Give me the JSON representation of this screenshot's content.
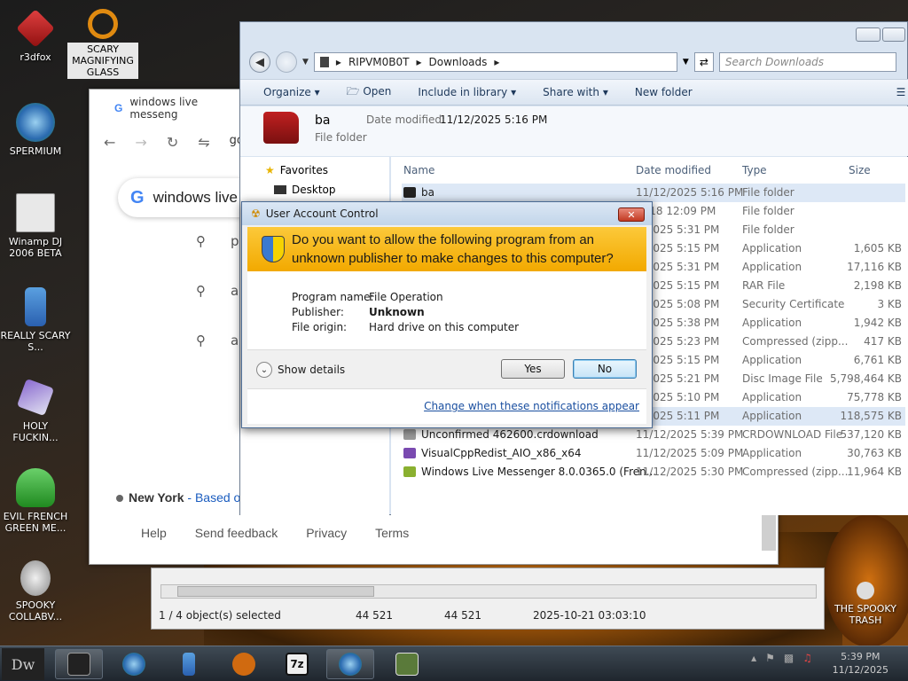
{
  "desktop": {
    "icons": [
      {
        "label": "r3dfox"
      },
      {
        "label": "SCARY MAGNIFYING GLASS"
      },
      {
        "label": "SPERMIUM"
      },
      {
        "label": "Winamp DJ 2006 BETA"
      },
      {
        "label": "REALLY SCARY S..."
      },
      {
        "label": "HOLY FUCKIN..."
      },
      {
        "label": "EVIL FRENCH GREEN ME..."
      },
      {
        "label": "SPOOKY COLLABV..."
      },
      {
        "label": "THE SPOOKY TRASH"
      }
    ]
  },
  "browser": {
    "tab_title": "windows live messeng",
    "search_query": "windows live",
    "suggestions": [
      "p",
      "a",
      "a"
    ],
    "location_city": "New York",
    "location_link": "- Based or",
    "footer_links": [
      "Help",
      "Send feedback",
      "Privacy",
      "Terms"
    ],
    "address_fragment": "go"
  },
  "explorer": {
    "breadcrumb": [
      "RIPVM0B0T",
      "Downloads"
    ],
    "search_placeholder": "Search Downloads",
    "toolbar": [
      "Organize",
      "Open",
      "Include in library",
      "Share with",
      "New folder"
    ],
    "details": {
      "name": "ba",
      "type": "File folder",
      "date_label": "Date modified:",
      "date_value": "11/12/2025 5:16 PM"
    },
    "nav": {
      "favorites": "Favorites",
      "desktop": "Desktop"
    },
    "columns": {
      "name": "Name",
      "date": "Date modified",
      "type": "Type",
      "size": "Size"
    },
    "rows": [
      {
        "name": "ba",
        "date": "11/12/2025 5:16 PM",
        "type": "File folder",
        "size": ""
      },
      {
        "name": "",
        "date": "2018 12:09 PM",
        "type": "File folder",
        "size": ""
      },
      {
        "name": "",
        "date": "2/2025 5:31 PM",
        "type": "File folder",
        "size": ""
      },
      {
        "name": "",
        "date": "2/2025 5:15 PM",
        "type": "Application",
        "size": "1,605 KB"
      },
      {
        "name": "",
        "date": "2/2025 5:31 PM",
        "type": "Application",
        "size": "17,116 KB"
      },
      {
        "name": "",
        "date": "2/2025 5:15 PM",
        "type": "RAR File",
        "size": "2,198 KB"
      },
      {
        "name": "",
        "date": "2/2025 5:08 PM",
        "type": "Security Certificate",
        "size": "3 KB"
      },
      {
        "name": "",
        "date": "2/2025 5:38 PM",
        "type": "Application",
        "size": "1,942 KB"
      },
      {
        "name": "",
        "date": "2/2025 5:23 PM",
        "type": "Compressed (zipp...",
        "size": "417 KB"
      },
      {
        "name": "",
        "date": "2/2025 5:15 PM",
        "type": "Application",
        "size": "6,761 KB"
      },
      {
        "name": "",
        "date": "2/2025 5:21 PM",
        "type": "Disc Image File",
        "size": "5,798,464 KB"
      },
      {
        "name": "",
        "date": "2/2025 5:10 PM",
        "type": "Application",
        "size": "75,778 KB"
      },
      {
        "name": "",
        "date": "2/2025 5:11 PM",
        "type": "Application",
        "size": "118,575 KB"
      },
      {
        "name": "Unconfirmed 462600.crdownload",
        "date": "11/12/2025 5:39 PM",
        "type": "CRDOWNLOAD File",
        "size": "537,120 KB"
      },
      {
        "name": "VisualCppRedist_AIO_x86_x64",
        "date": "11/12/2025 5:09 PM",
        "type": "Application",
        "size": "30,763 KB"
      },
      {
        "name": "Windows Live Messenger 8.0.0365.0 (Fren...",
        "date": "11/12/2025 5:30 PM",
        "type": "Compressed (zipp...",
        "size": "11,964 KB"
      }
    ]
  },
  "statusbar": {
    "selected": "1 / 4 object(s) selected",
    "size1": "44 521",
    "size2": "44 521",
    "datetime": "2025-10-21 03:03:10"
  },
  "uac": {
    "title": "User Account Control",
    "question": "Do you want to allow the following program from an unknown publisher to make changes to this computer?",
    "program_label": "Program name:",
    "program_value": "File Operation",
    "publisher_label": "Publisher:",
    "publisher_value": "Unknown",
    "origin_label": "File origin:",
    "origin_value": "Hard drive on this computer",
    "show_details": "Show details",
    "yes": "Yes",
    "no": "No",
    "change_link": "Change when these notifications appear"
  },
  "taskbar": {
    "start_label": "Dw",
    "time": "5:39 PM",
    "date": "11/12/2025"
  }
}
